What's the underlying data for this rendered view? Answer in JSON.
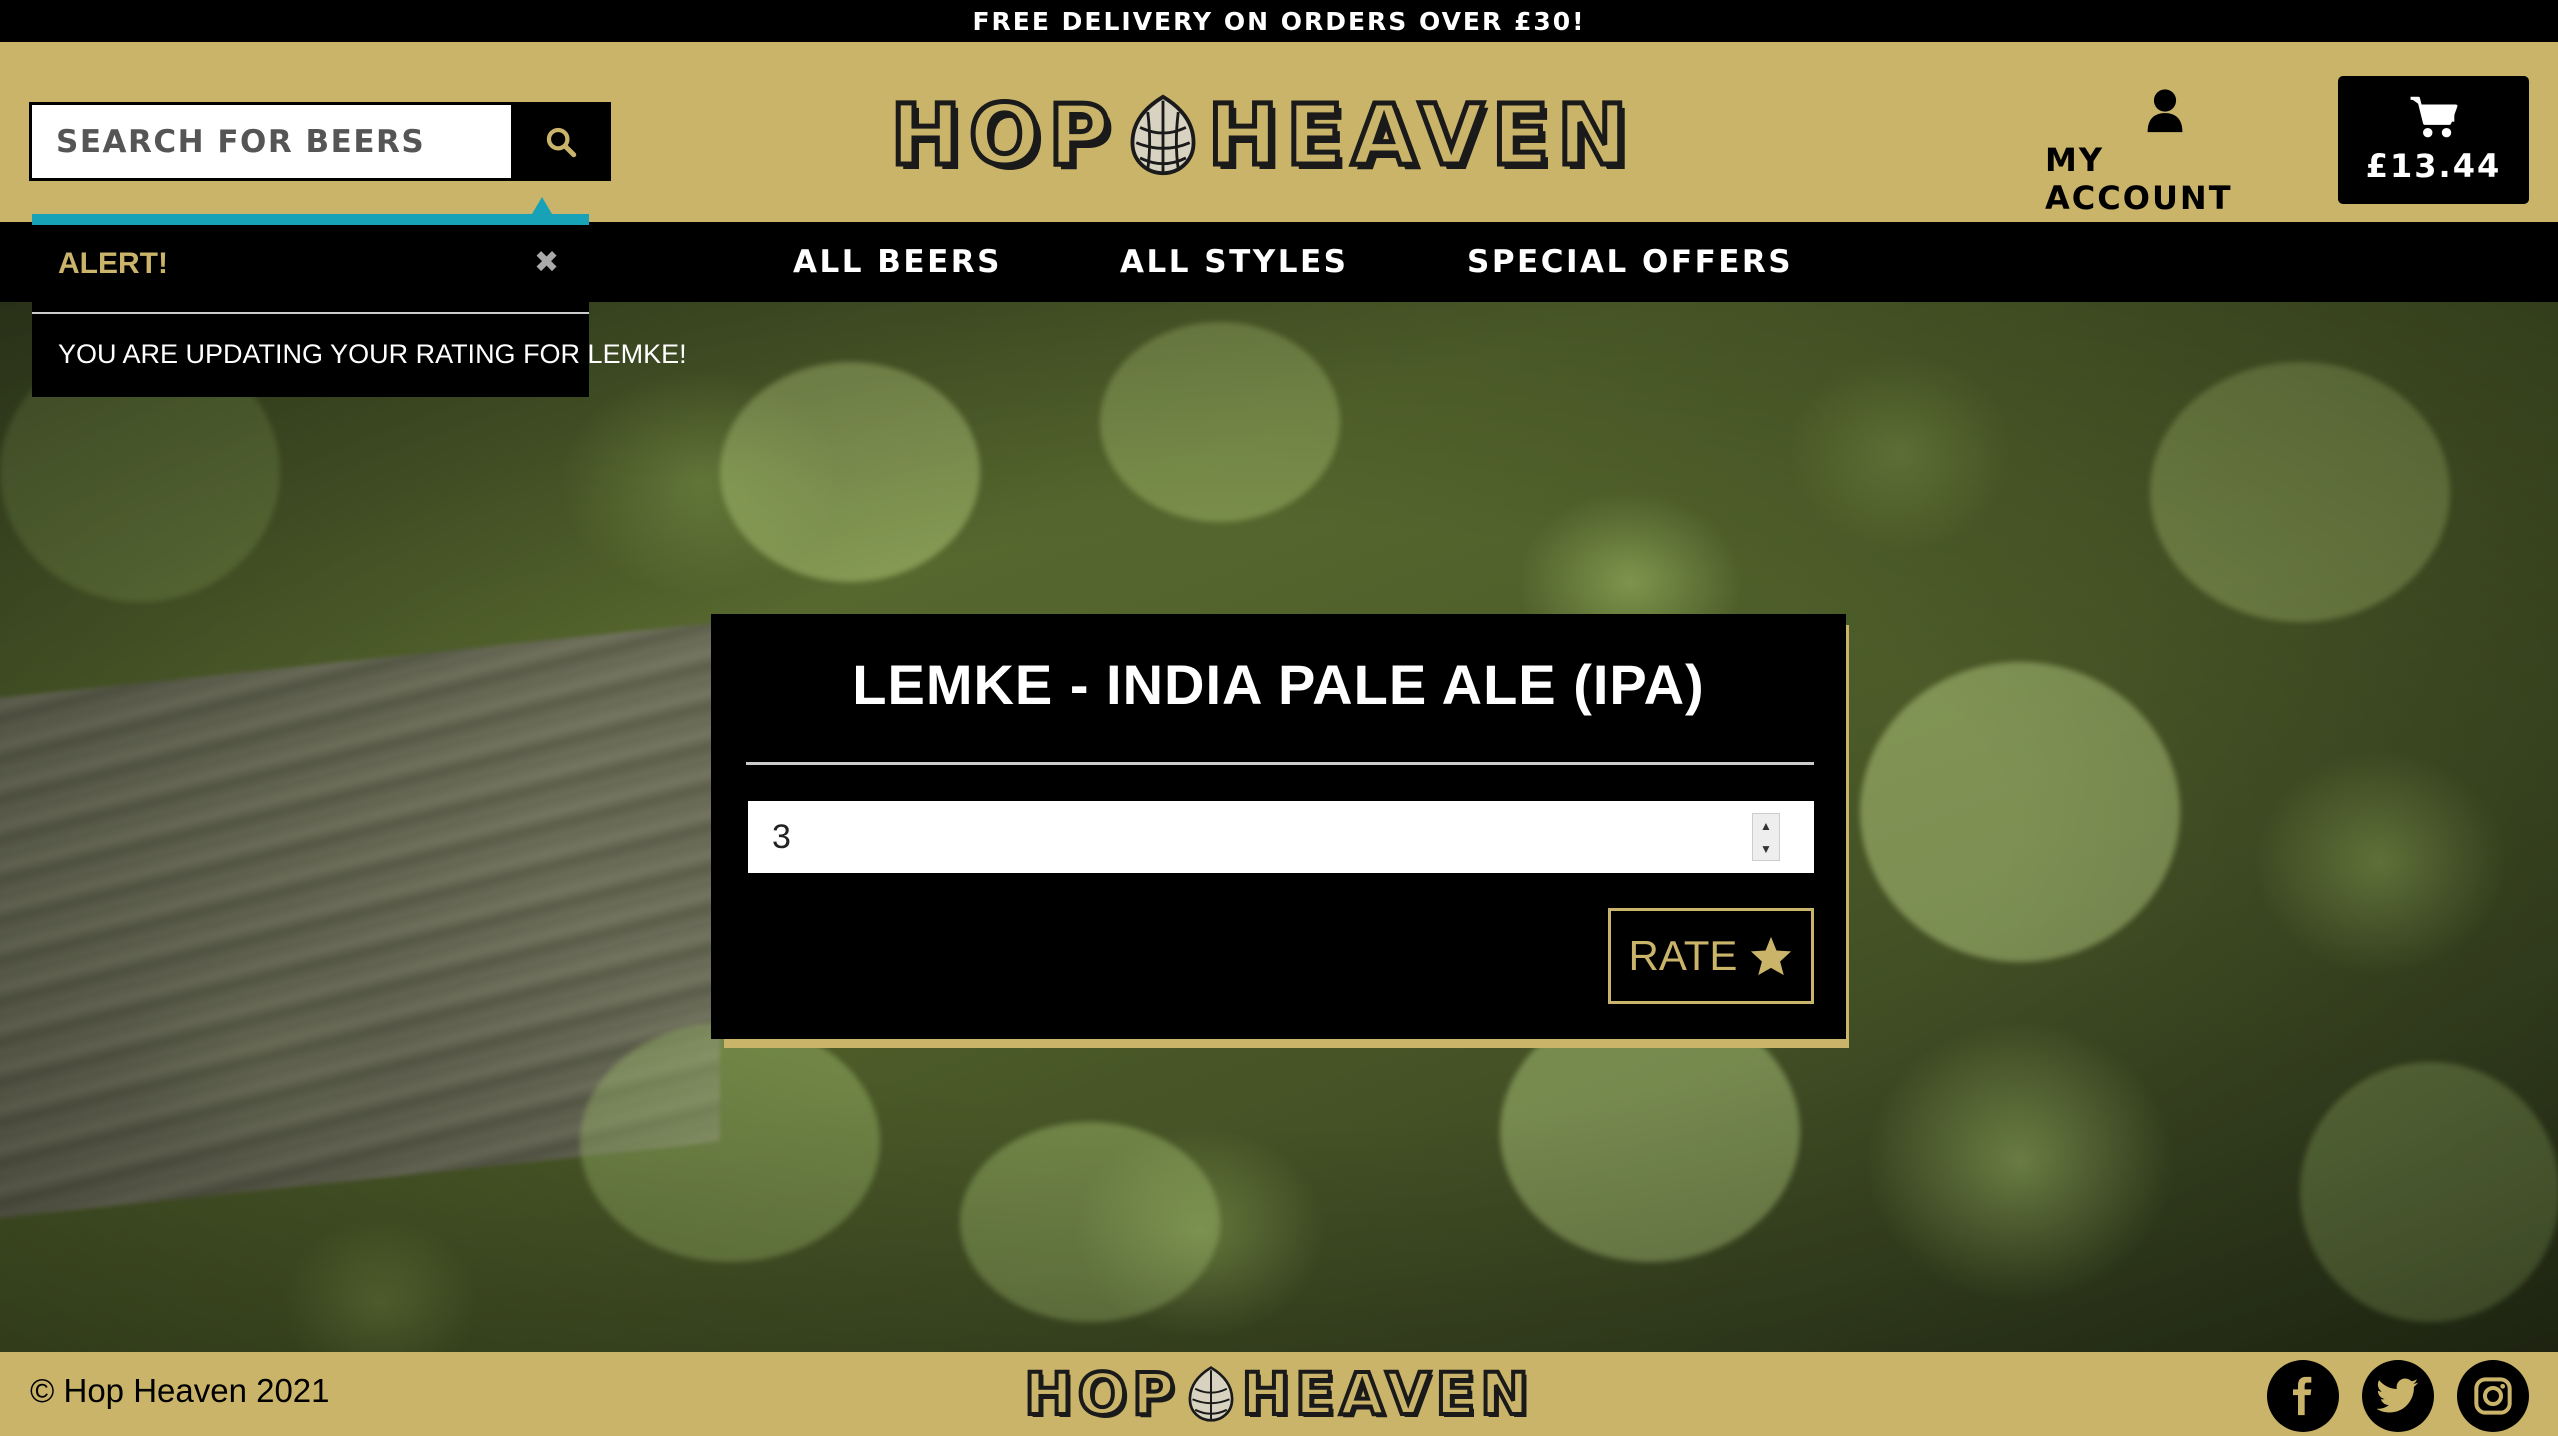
{
  "banner": {
    "text": "FREE DELIVERY ON ORDERS OVER £30!"
  },
  "header": {
    "search": {
      "placeholder": "SEARCH FOR BEERS"
    },
    "logo": {
      "left": "HOP",
      "right": "HEAVEN"
    },
    "account_label": "MY ACCOUNT",
    "cart_total": "£13.44"
  },
  "nav": {
    "items": [
      {
        "label": "ALL BEERS"
      },
      {
        "label": "ALL STYLES"
      },
      {
        "label": "SPECIAL OFFERS"
      }
    ]
  },
  "alert": {
    "title": "ALERT!",
    "close": "✖",
    "message": "YOU ARE UPDATING YOUR RATING FOR LEMKE!"
  },
  "rating_card": {
    "title": "LEMKE - INDIA PALE ALE (IPA)",
    "rating_value": "3",
    "rate_button": "RATE"
  },
  "footer": {
    "copyright": "© Hop Heaven 2021",
    "logo": {
      "left": "HOP",
      "right": "HEAVEN"
    },
    "social": [
      "facebook-icon",
      "twitter-icon",
      "instagram-icon"
    ]
  },
  "colors": {
    "brand_gold": "#c9b46a",
    "black": "#000000",
    "alert_accent": "#17a2b8"
  }
}
